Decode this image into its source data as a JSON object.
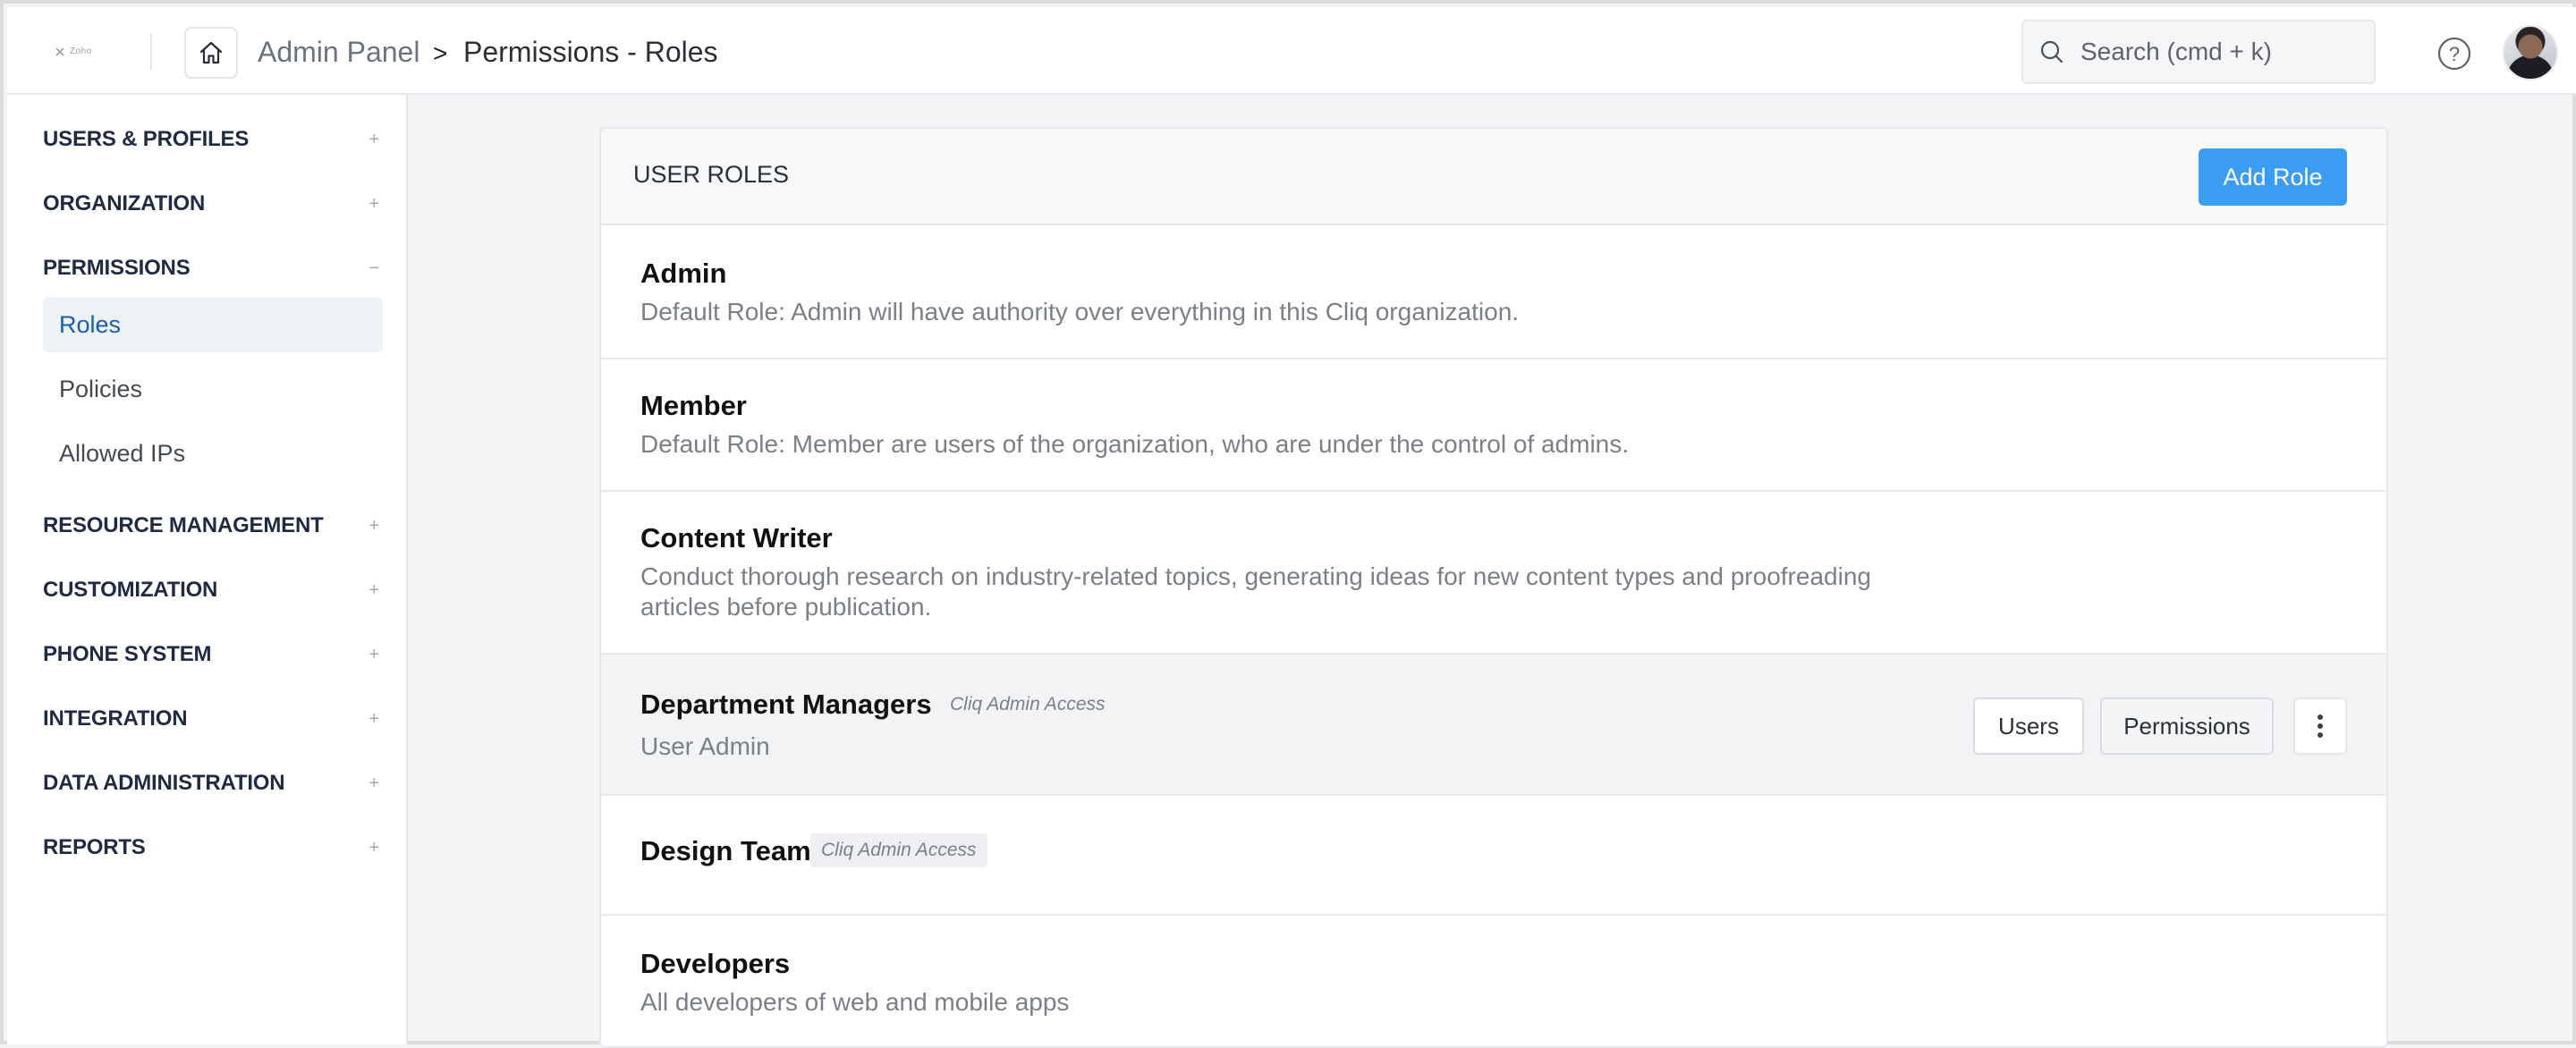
{
  "header": {
    "logo_text": "Zoho",
    "breadcrumb_root": "Admin Panel",
    "breadcrumb_separator": ">",
    "breadcrumb_current": "Permissions - Roles",
    "search_placeholder": "Search (cmd + k)",
    "help_symbol": "?"
  },
  "sidebar": {
    "sections": [
      {
        "label": "USERS & PROFILES",
        "toggle": "+"
      },
      {
        "label": "ORGANIZATION",
        "toggle": "+"
      },
      {
        "label": "PERMISSIONS",
        "toggle": "−"
      },
      {
        "label": "RESOURCE MANAGEMENT",
        "toggle": "+"
      },
      {
        "label": "CUSTOMIZATION",
        "toggle": "+"
      },
      {
        "label": "PHONE SYSTEM",
        "toggle": "+"
      },
      {
        "label": "INTEGRATION",
        "toggle": "+"
      },
      {
        "label": "DATA ADMINISTRATION",
        "toggle": "+"
      },
      {
        "label": "REPORTS",
        "toggle": "+"
      }
    ],
    "permissions_items": [
      {
        "label": "Roles",
        "active": true
      },
      {
        "label": "Policies",
        "active": false
      },
      {
        "label": "Allowed IPs",
        "active": false
      }
    ]
  },
  "main": {
    "title": "USER ROLES",
    "add_button": "Add Role",
    "roles": [
      {
        "name": "Admin",
        "description": "Default Role: Admin will have authority over everything in this Cliq organization."
      },
      {
        "name": "Member",
        "description": "Default Role: Member are users of the organization, who are under the control of admins."
      },
      {
        "name": "Content Writer",
        "description_line1": "Conduct thorough research on industry-related topics, generating ideas for new content types and proofreading",
        "description_line2": "articles before publication."
      },
      {
        "name": "Department Managers",
        "badge": "Cliq Admin Access",
        "description": "User Admin",
        "users_button": "Users",
        "permissions_button": "Permissions"
      },
      {
        "name": "Design Team",
        "badge": "Cliq Admin Access"
      },
      {
        "name": "Developers",
        "description": "All developers of web and mobile apps"
      }
    ]
  },
  "colors": {
    "accent": "#3b9cf3",
    "active_nav_bg": "#edf2f7",
    "active_nav_text": "#1c5fa8"
  }
}
